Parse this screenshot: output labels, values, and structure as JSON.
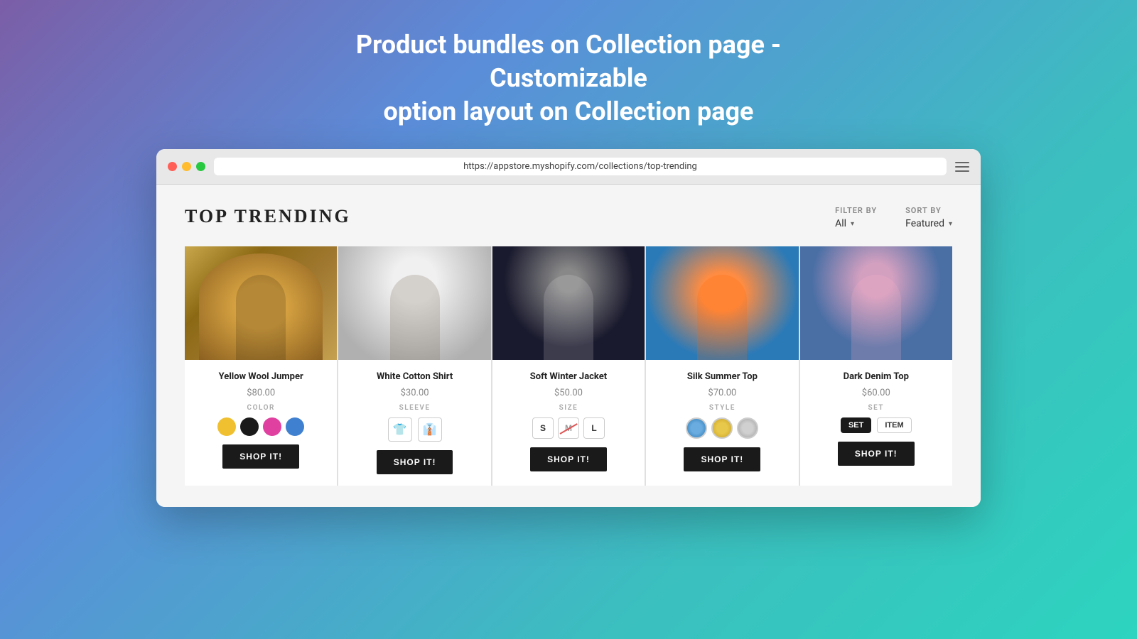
{
  "page": {
    "title_line1": "Product bundles on Collection page - Customizable",
    "title_line2": "option layout on Collection page"
  },
  "browser": {
    "url": "https://appstore.myshopify.com/collections/top-trending"
  },
  "collection": {
    "title": "TOP TRENDING",
    "filter_label": "FILTER BY",
    "filter_value": "All",
    "sort_label": "SORT BY",
    "sort_value": "Featured"
  },
  "products": [
    {
      "id": "yellow-wool-jumper",
      "name": "Yellow Wool Jumper",
      "price": "$80.00",
      "option_type": "COLOR",
      "option_label": "COLOR",
      "shop_btn": "SHOP IT!",
      "img_class": "img-yellow-jumper"
    },
    {
      "id": "white-cotton-shirt",
      "name": "White Cotton Shirt",
      "price": "$30.00",
      "option_type": "SLEEVE",
      "option_label": "SLEEVE",
      "shop_btn": "SHOP IT!",
      "img_class": "img-white-shirt"
    },
    {
      "id": "soft-winter-jacket",
      "name": "Soft Winter Jacket",
      "price": "$50.00",
      "option_type": "SIZE",
      "option_label": "SIZE",
      "shop_btn": "SHOP IT!",
      "img_class": "img-winter-jacket"
    },
    {
      "id": "silk-summer-top",
      "name": "Silk Summer Top",
      "price": "$70.00",
      "option_type": "STYLE",
      "option_label": "STYLE",
      "shop_btn": "SHOP IT!",
      "img_class": "img-silk-top"
    },
    {
      "id": "dark-denim-top",
      "name": "Dark Denim Top",
      "price": "$60.00",
      "option_type": "SET",
      "option_label": "SET",
      "shop_btn": "SHOP IT!",
      "img_class": "img-denim-top"
    }
  ]
}
